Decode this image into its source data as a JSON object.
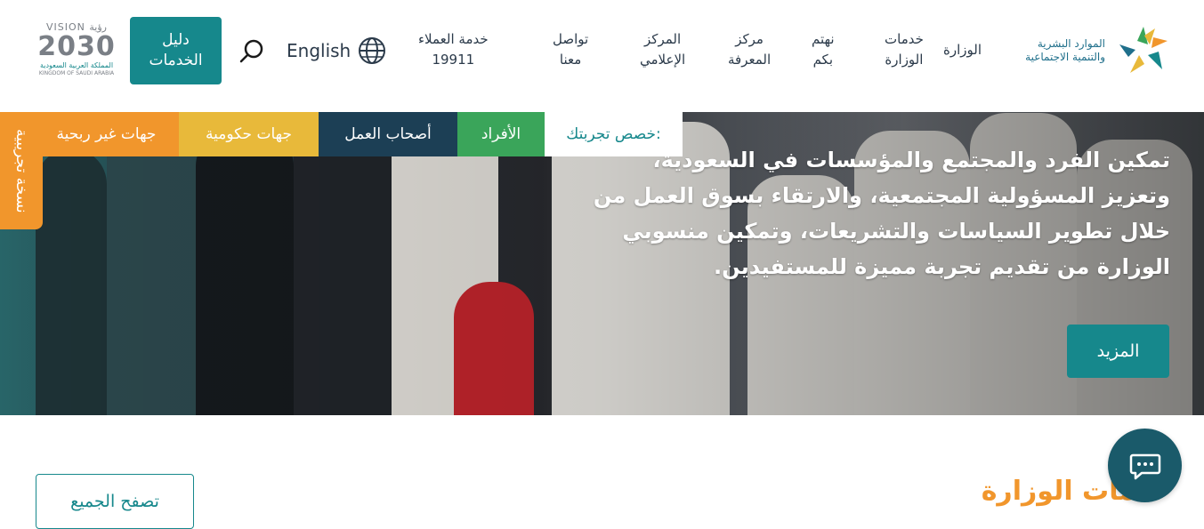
{
  "header": {
    "logo_text_line1": "الموارد البشرية",
    "logo_text_line2": "والتنمية الاجتماعية",
    "nav": [
      {
        "line1": "الوزارة",
        "line2": ""
      },
      {
        "line1": "خدمات",
        "line2": "الوزارة"
      },
      {
        "line1": "نهتم",
        "line2": "بكم"
      },
      {
        "line1": "مركز",
        "line2": "المعرفة"
      },
      {
        "line1": "المركز",
        "line2": "الإعلامي"
      },
      {
        "line1": "تواصل",
        "line2": "معنا"
      },
      {
        "line1": "خدمة العملاء",
        "line2": "19911"
      }
    ],
    "language_label": "English",
    "services_guide_line1": "دليل",
    "services_guide_line2": "الخدمات",
    "vision_top": "VISION رؤية",
    "vision_year": "2030",
    "vision_ar": "المملكة العربية السعودية",
    "vision_en": "KINGDOM OF SAUDI ARABIA"
  },
  "personalize": {
    "label": "خصص تجربتك:",
    "tabs": [
      {
        "label": "الأفراد",
        "color": "#3aa55a"
      },
      {
        "label": "أصحاب العمل",
        "color": "#1c3f55"
      },
      {
        "label": "جهات حكومية",
        "color": "#e8b93a"
      },
      {
        "label": "جهات غير ربحية",
        "color": "#f1962c"
      }
    ]
  },
  "beta_tag": "نسخة تجريبية",
  "hero": {
    "text": "تمكين الفرد والمجتمع والمؤسسات في السعودية، وتعزيز المسؤولية المجتمعية، والارتقاء بسوق العمل من خلال تطوير السياسات والتشريعات، وتمكين منسوبي الوزارة من تقديم تجربة مميزة للمستفيدين.",
    "more_label": "المزيد"
  },
  "services": {
    "title": "خدمات الوزارة",
    "browse_all_label": "تصفح الجميع"
  },
  "colors": {
    "teal": "#16888c",
    "orange": "#f1962c",
    "green": "#3aa55a",
    "navy": "#1c3f55",
    "yellow": "#e8b93a"
  }
}
